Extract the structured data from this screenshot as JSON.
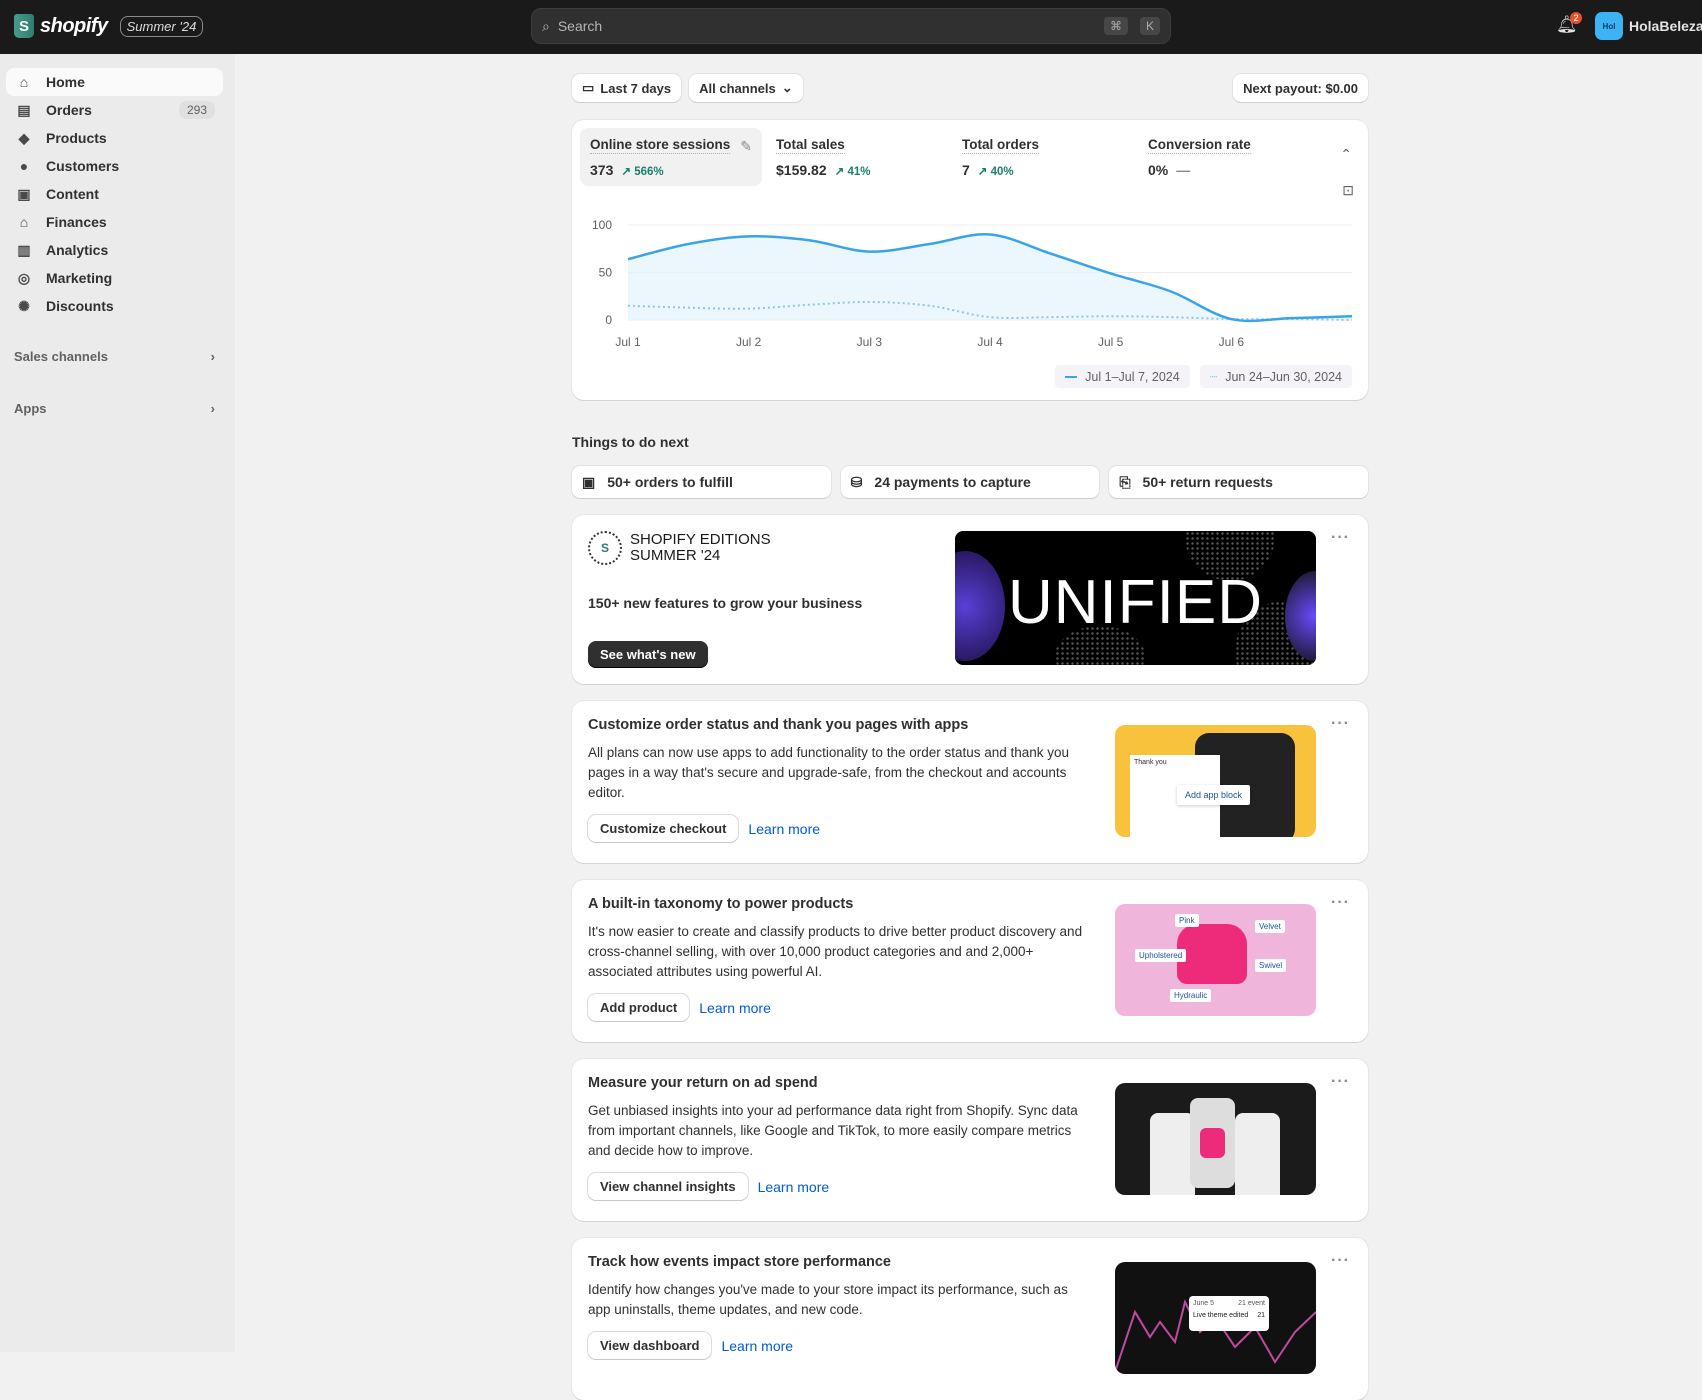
{
  "topbar": {
    "brand": "shopify",
    "edition_badge": "Summer '24",
    "search_placeholder": "Search",
    "shortcut_keys": [
      "⌘",
      "K"
    ],
    "notification_count": "2",
    "user_initials": "Hol",
    "user_name": "HolaBeleza"
  },
  "sidebar": {
    "items": [
      {
        "label": "Home",
        "icon": "home-icon",
        "active": true
      },
      {
        "label": "Orders",
        "icon": "inbox-icon",
        "count": "293"
      },
      {
        "label": "Products",
        "icon": "tag-icon"
      },
      {
        "label": "Customers",
        "icon": "person-icon"
      },
      {
        "label": "Content",
        "icon": "image-icon"
      },
      {
        "label": "Finances",
        "icon": "bank-icon"
      },
      {
        "label": "Analytics",
        "icon": "bar-chart-icon"
      },
      {
        "label": "Marketing",
        "icon": "target-icon"
      },
      {
        "label": "Discounts",
        "icon": "discount-icon"
      }
    ],
    "sections": [
      "Sales channels",
      "Apps"
    ]
  },
  "filters": {
    "date_range": "Last 7 days",
    "channels": "All channels",
    "payout": "Next payout: $0.00"
  },
  "metrics": [
    {
      "title": "Online store sessions",
      "value": "373",
      "delta": "566%"
    },
    {
      "title": "Total sales",
      "value": "$159.82",
      "delta": "41%"
    },
    {
      "title": "Total orders",
      "value": "7",
      "delta": "40%"
    },
    {
      "title": "Conversion rate",
      "value": "0%",
      "delta": "—"
    }
  ],
  "chart_data": {
    "type": "line",
    "title": "Online store sessions",
    "x_labels": [
      "Jul 1",
      "Jul 2",
      "Jul 3",
      "Jul 4",
      "Jul 5",
      "Jul 6"
    ],
    "x": [
      0,
      0.5,
      1,
      1.5,
      2,
      2.5,
      3,
      3.5,
      4,
      4.5,
      5,
      5.5,
      6
    ],
    "y_ticks": [
      "0",
      "50",
      "100"
    ],
    "ylim": [
      0,
      100
    ],
    "series": [
      {
        "name": "Jul 1–Jul 7, 2024",
        "style": "solid",
        "color": "#3ba4e6",
        "values": [
          64,
          80,
          88,
          84,
          72,
          80,
          90,
          70,
          49,
          30,
          1,
          2,
          4
        ]
      },
      {
        "name": "Jun 24–Jun 30, 2024",
        "style": "dotted",
        "color": "#8cc6ec",
        "values": [
          15,
          13,
          12,
          16,
          19,
          15,
          3,
          3,
          4,
          3,
          1,
          1,
          0
        ]
      }
    ],
    "grid": true,
    "legend": "bottom-right"
  },
  "things": {
    "heading": "Things to do next",
    "tasks": [
      "50+ orders to fulfill",
      "24 payments to capture",
      "50+ return requests"
    ]
  },
  "editions": {
    "title_line1": "SHOPIFY EDITIONS",
    "title_line2": "SUMMER '24",
    "subtitle": "150+ new features to grow your business",
    "cta": "See what's new",
    "image_text": "UNIFIED"
  },
  "cards": [
    {
      "title": "Customize order status and thank you pages with apps",
      "body": "All plans can now use apps to add functionality to the order status and thank you pages in a way that's secure and upgrade-safe, from the checkout and accounts editor.",
      "button": "Customize checkout",
      "link": "Learn more",
      "image_labels": [
        "Thank you",
        "Add app block"
      ]
    },
    {
      "title": "A built-in taxonomy to power products",
      "body": "It's now easier to create and classify products to drive better product discovery and cross-channel selling, with over 10,000 product categories and and 2,000+ associated attributes using powerful AI.",
      "button": "Add product",
      "link": "Learn more",
      "image_labels": [
        "Pink",
        "Velvet",
        "Upholstered",
        "Swivel",
        "Hydraulic"
      ]
    },
    {
      "title": "Measure your return on ad spend",
      "body": "Get unbiased insights into your ad performance data right from Shopify. Sync data from important channels, like Google and TikTok, to more easily compare metrics and decide how to improve.",
      "button": "View channel insights",
      "link": "Learn more",
      "image_labels": []
    },
    {
      "title": "Track how events impact store performance",
      "body": "Identify how changes you've made to your store impact its performance, such as app uninstalls, theme updates, and new code.",
      "button": "View dashboard",
      "link": "Learn more",
      "image_labels": [
        "June 5",
        "21 event",
        "Live theme edited",
        "21"
      ]
    }
  ]
}
